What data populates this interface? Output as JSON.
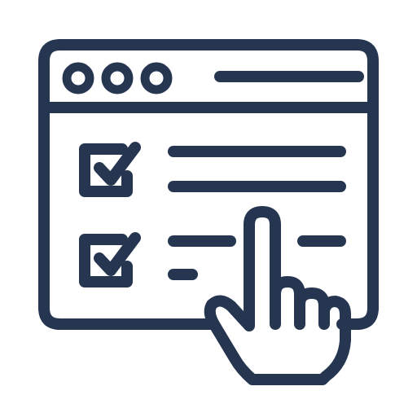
{
  "icon": {
    "subject": "browser-checklist-hand-icon",
    "stroke_color": "#263650",
    "background_color": "#ffffff",
    "window_controls": [
      "circle-icon",
      "circle-icon",
      "circle-icon"
    ],
    "checklist": {
      "items": [
        {
          "state": "checked",
          "glyph": "checkbox-checked-icon"
        },
        {
          "state": "checked",
          "glyph": "checkbox-checked-icon"
        }
      ]
    },
    "pointer": "pointing-hand-icon"
  }
}
